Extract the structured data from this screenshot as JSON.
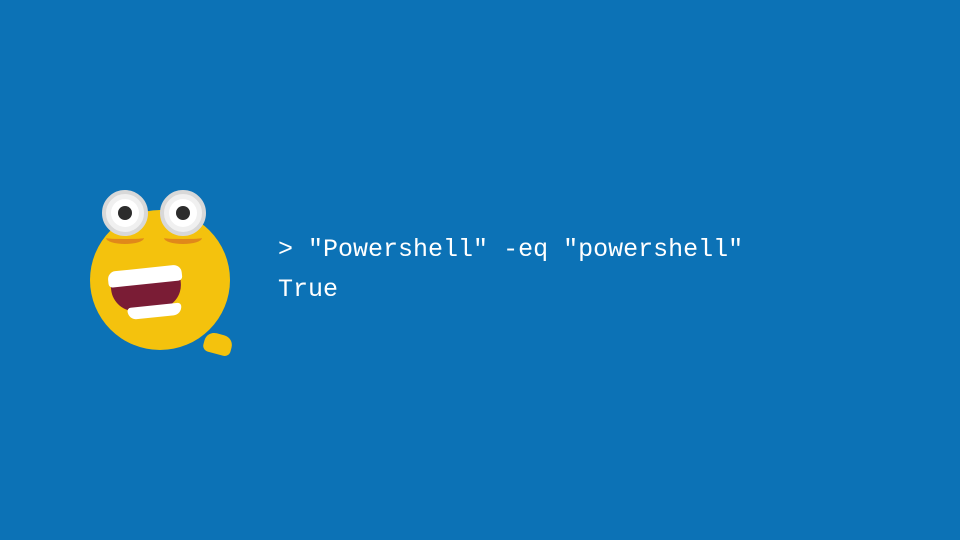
{
  "code": {
    "line1_prompt": ">",
    "line1_cmd": "\"Powershell\" -eq \"powershell\"",
    "line2_output": "True"
  },
  "emoji": {
    "name": "shocked-face",
    "color": "#f4c20d"
  },
  "colors": {
    "background": "#0c72b6",
    "text": "#ffffff"
  }
}
